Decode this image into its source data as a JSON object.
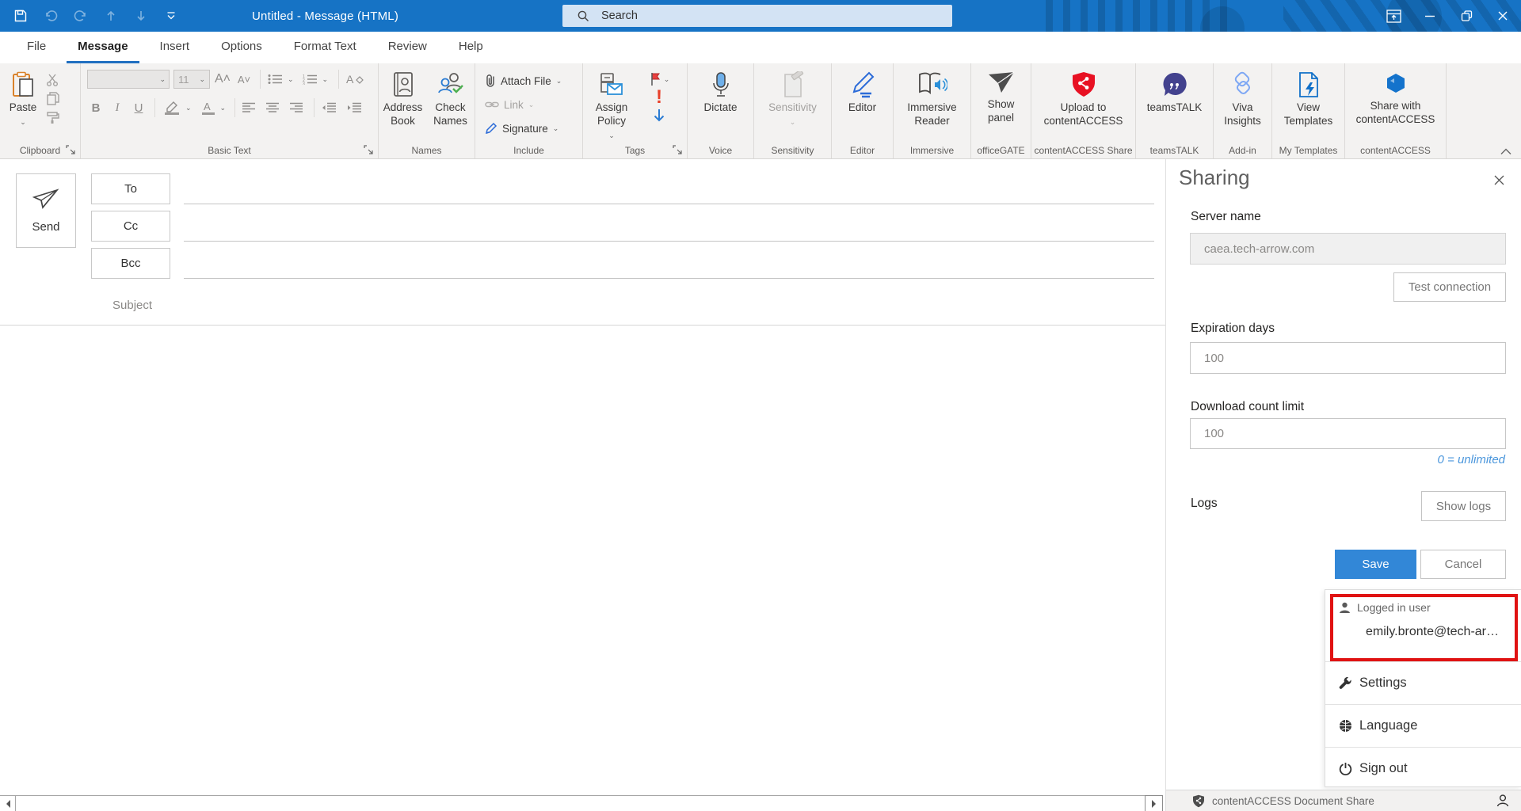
{
  "titlebar": {
    "title": "Untitled  -  Message (HTML)",
    "search_placeholder": "Search"
  },
  "tabs": {
    "file": "File",
    "message": "Message",
    "insert": "Insert",
    "options": "Options",
    "format_text": "Format Text",
    "review": "Review",
    "help": "Help"
  },
  "ribbon": {
    "paste": "Paste",
    "clipboard_group": "Clipboard",
    "font_size": "11",
    "bold": "B",
    "italic": "I",
    "underline": "U",
    "basic_text_group": "Basic Text",
    "address_book": "Address Book",
    "check_names": "Check Names",
    "names_group": "Names",
    "attach_file": "Attach File",
    "link": "Link",
    "signature": "Signature",
    "include_group": "Include",
    "assign_policy": "Assign Policy",
    "exclamation": "!",
    "tags_group": "Tags",
    "dictate": "Dictate",
    "voice_group": "Voice",
    "sensitivity": "Sensitivity",
    "sensitivity_group": "Sensitivity",
    "editor": "Editor",
    "editor_group": "Editor",
    "immersive_reader": "Immersive Reader",
    "immersive_group": "Immersive",
    "show_panel": "Show panel",
    "officegate_group": "officeGATE",
    "upload_to_contentaccess": "Upload to contentACCESS",
    "contentaccess_share_group": "contentACCESS Share",
    "teamstalk": "teamsTALK",
    "teamstalk_group": "teamsTALK",
    "viva_insights": "Viva Insights",
    "addin_group": "Add-in",
    "view_templates": "View Templates",
    "my_templates_group": "My Templates",
    "share_with_contentaccess": "Share with contentACCESS",
    "contentaccess_group": "contentACCESS"
  },
  "compose": {
    "send": "Send",
    "to": "To",
    "cc": "Cc",
    "bcc": "Bcc",
    "subject": "Subject"
  },
  "sharing": {
    "title": "Sharing",
    "server_label": "Server name",
    "server_value": "caea.tech-arrow.com",
    "test_connection": "Test connection",
    "expiration_label": "Expiration days",
    "expiration_value": "100",
    "download_label": "Download count limit",
    "download_value": "100",
    "unlimited_hint": "0 = unlimited",
    "logs_label": "Logs",
    "show_logs": "Show logs",
    "save": "Save",
    "cancel": "Cancel"
  },
  "user_menu": {
    "logged_in_label": "Logged in user",
    "email": "emily.bronte@tech-ar…",
    "settings": "Settings",
    "language": "Language",
    "sign_out": "Sign out"
  },
  "statusbar": {
    "app_name": "contentACCESS Document Share"
  },
  "colors": {
    "titlebar_blue": "#1673c5",
    "tab_accent": "#2170c0",
    "save_button_blue": "#3287d7",
    "annotation_red": "#e01212",
    "upload_shield_red": "#e81123",
    "teamstalk_indigo": "#43428e",
    "hint_blue": "#4a96dc"
  }
}
